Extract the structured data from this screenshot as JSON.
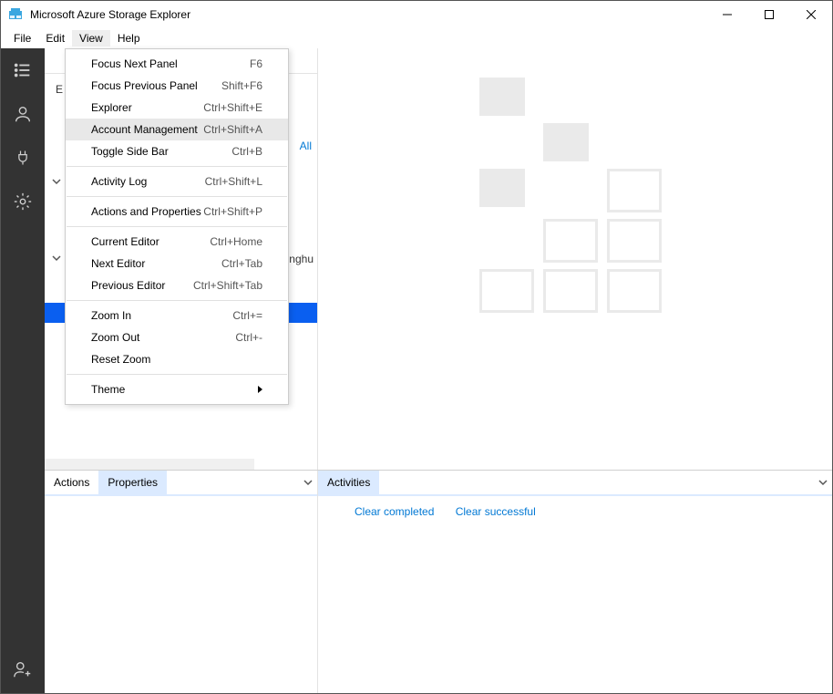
{
  "window": {
    "title": "Microsoft Azure Storage Explorer"
  },
  "menubar": {
    "items": [
      "File",
      "Edit",
      "View",
      "Help"
    ],
    "open_index": 2
  },
  "view_menu": {
    "items": [
      {
        "label": "Focus Next Panel",
        "shortcut": "F6"
      },
      {
        "label": "Focus Previous Panel",
        "shortcut": "Shift+F6"
      },
      {
        "label": "Explorer",
        "shortcut": "Ctrl+Shift+E"
      },
      {
        "label": "Account Management",
        "shortcut": "Ctrl+Shift+A",
        "hover": true
      },
      {
        "label": "Toggle Side Bar",
        "shortcut": "Ctrl+B"
      },
      {
        "sep": true
      },
      {
        "label": "Activity Log",
        "shortcut": "Ctrl+Shift+L"
      },
      {
        "sep": true
      },
      {
        "label": "Actions and Properties",
        "shortcut": "Ctrl+Shift+P"
      },
      {
        "sep": true
      },
      {
        "label": "Current Editor",
        "shortcut": "Ctrl+Home"
      },
      {
        "label": "Next Editor",
        "shortcut": "Ctrl+Tab"
      },
      {
        "label": "Previous Editor",
        "shortcut": "Ctrl+Shift+Tab"
      },
      {
        "sep": true
      },
      {
        "label": "Zoom In",
        "shortcut": "Ctrl+="
      },
      {
        "label": "Zoom Out",
        "shortcut": "Ctrl+-"
      },
      {
        "label": "Reset Zoom",
        "shortcut": ""
      },
      {
        "sep": true
      },
      {
        "label": "Theme",
        "shortcut": "",
        "submenu": true
      }
    ]
  },
  "activitybar": {
    "icons": [
      "list-icon",
      "person-icon",
      "plug-icon",
      "gear-icon"
    ],
    "bottom_icon": "add-person-icon"
  },
  "explorer": {
    "peek_text_left": "E",
    "peek_link_right": "All",
    "peek_partial": "nghu"
  },
  "panels": {
    "left_tabs": [
      "Actions",
      "Properties"
    ],
    "left_active": 1,
    "right_tabs": [
      "Activities"
    ],
    "right_active": 0,
    "activities_links": [
      "Clear completed",
      "Clear successful"
    ]
  }
}
